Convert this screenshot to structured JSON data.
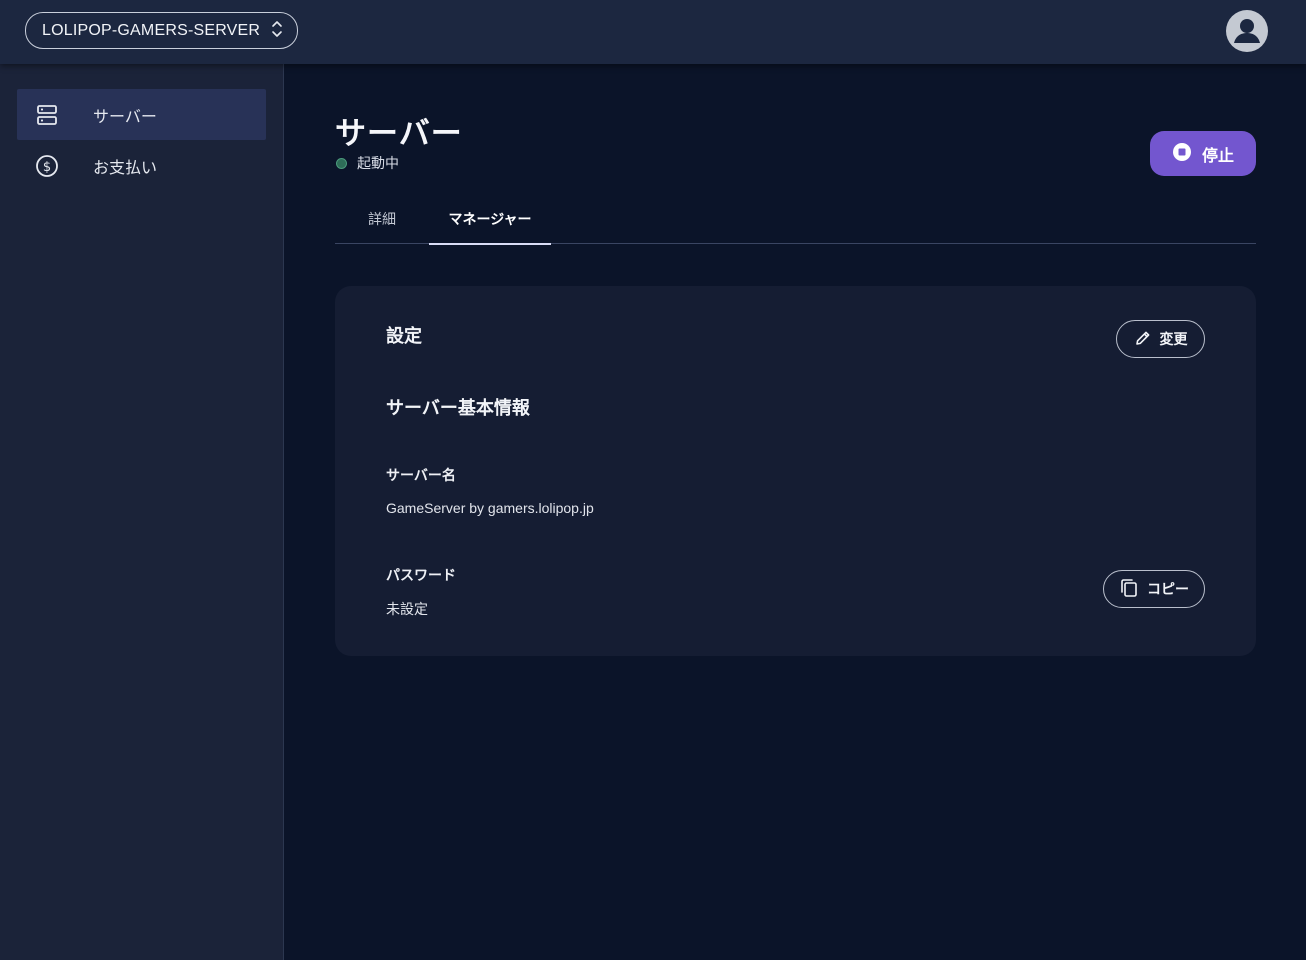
{
  "header": {
    "server_selector": {
      "label": "LOLIPOP-GAMERS-SERVER",
      "icon": "chevron-up-down-icon"
    },
    "account": {
      "icon": "user-avatar-icon"
    }
  },
  "sidebar": {
    "items": [
      {
        "label": "サーバー",
        "icon": "server-icon",
        "active": true
      },
      {
        "label": "お支払い",
        "icon": "dollar-circle-icon",
        "active": false
      }
    ]
  },
  "main": {
    "title": "サーバー",
    "status": {
      "text": "起動中",
      "color": "#2e6d58"
    },
    "stop_button": {
      "label": "停止",
      "icon": "stop-circle-icon",
      "color": "#7356cf"
    },
    "tabs": [
      {
        "label": "詳細",
        "active": false
      },
      {
        "label": "マネージャー",
        "active": true
      }
    ],
    "card": {
      "title": "設定",
      "edit_button": {
        "label": "変更",
        "icon": "pencil-icon"
      },
      "section_title": "サーバー基本情報",
      "fields": [
        {
          "label": "サーバー名",
          "value": "GameServer by gamers.lolipop.jp"
        },
        {
          "label": "パスワード",
          "value": "未設定"
        }
      ],
      "copy_button": {
        "label": "コピー",
        "icon": "copy-icon"
      }
    }
  }
}
